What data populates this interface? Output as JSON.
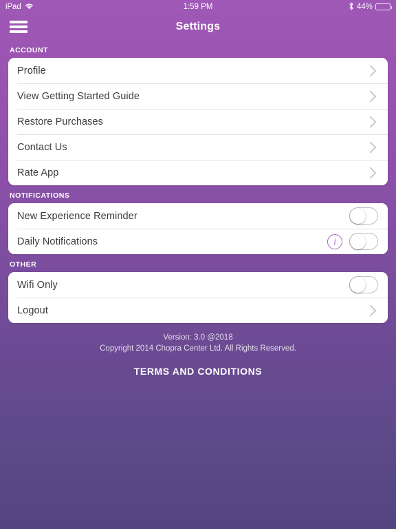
{
  "status_bar": {
    "device": "iPad",
    "wifi_icon": "wifi-icon",
    "time": "1:59 PM",
    "bluetooth_icon": "bluetooth-icon",
    "battery_percent": "44%",
    "battery_level": 44
  },
  "nav": {
    "menu_icon": "hamburger-menu-icon",
    "title": "Settings"
  },
  "sections": [
    {
      "header": "ACCOUNT",
      "rows": [
        {
          "label": "Profile",
          "accessory": "chevron"
        },
        {
          "label": "View Getting Started Guide",
          "accessory": "chevron"
        },
        {
          "label": "Restore Purchases",
          "accessory": "chevron"
        },
        {
          "label": "Contact Us",
          "accessory": "chevron"
        },
        {
          "label": "Rate App",
          "accessory": "chevron"
        }
      ]
    },
    {
      "header": "NOTIFICATIONS",
      "rows": [
        {
          "label": "New Experience Reminder",
          "accessory": "toggle",
          "toggle_on": false
        },
        {
          "label": "Daily Notifications",
          "accessory": "info+toggle",
          "toggle_on": false,
          "info_icon": "info-icon"
        }
      ]
    },
    {
      "header": "OTHER",
      "rows": [
        {
          "label": "Wifi Only",
          "accessory": "toggle",
          "toggle_on": false
        },
        {
          "label": "Logout",
          "accessory": "chevron"
        }
      ]
    }
  ],
  "footer": {
    "version": "Version: 3.0 @2018",
    "copyright": "Copyright 2014 Chopra Center Ltd. All Rights Reserved.",
    "terms_label": "TERMS AND CONDITIONS"
  },
  "colors": {
    "background_top": "#9f58b6",
    "background_bottom": "#534480",
    "card": "#ffffff",
    "row_text": "#3b3b3d",
    "accent": "#a85fc4",
    "chevron": "#c9c9cf"
  }
}
